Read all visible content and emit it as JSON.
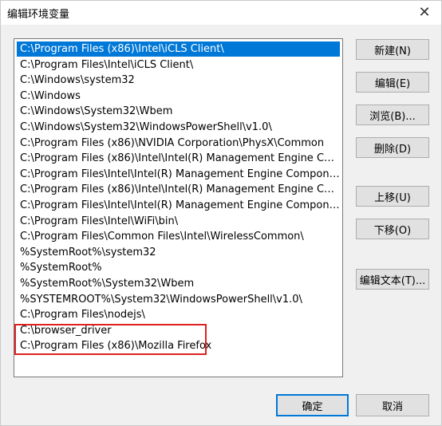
{
  "window": {
    "title": "编辑环境变量",
    "close_glyph": "✕"
  },
  "list": {
    "items": [
      {
        "text": "C:\\Program Files (x86)\\Intel\\iCLS Client\\",
        "selected": true
      },
      {
        "text": "C:\\Program Files\\Intel\\iCLS Client\\",
        "selected": false
      },
      {
        "text": "C:\\Windows\\system32",
        "selected": false
      },
      {
        "text": "C:\\Windows",
        "selected": false
      },
      {
        "text": "C:\\Windows\\System32\\Wbem",
        "selected": false
      },
      {
        "text": "C:\\Windows\\System32\\WindowsPowerShell\\v1.0\\",
        "selected": false
      },
      {
        "text": "C:\\Program Files (x86)\\NVIDIA Corporation\\PhysX\\Common",
        "selected": false
      },
      {
        "text": "C:\\Program Files (x86)\\Intel\\Intel(R) Management Engine Compon...",
        "selected": false
      },
      {
        "text": "C:\\Program Files\\Intel\\Intel(R) Management Engine Components\\...",
        "selected": false
      },
      {
        "text": "C:\\Program Files (x86)\\Intel\\Intel(R) Management Engine Compon...",
        "selected": false
      },
      {
        "text": "C:\\Program Files\\Intel\\Intel(R) Management Engine Components\\I...",
        "selected": false
      },
      {
        "text": "C:\\Program Files\\Intel\\WiFi\\bin\\",
        "selected": false
      },
      {
        "text": "C:\\Program Files\\Common Files\\Intel\\WirelessCommon\\",
        "selected": false
      },
      {
        "text": "%SystemRoot%\\system32",
        "selected": false
      },
      {
        "text": "%SystemRoot%",
        "selected": false
      },
      {
        "text": "%SystemRoot%\\System32\\Wbem",
        "selected": false
      },
      {
        "text": "%SYSTEMROOT%\\System32\\WindowsPowerShell\\v1.0\\",
        "selected": false
      },
      {
        "text": "C:\\Program Files\\nodejs\\",
        "selected": false
      },
      {
        "text": "C:\\browser_driver",
        "selected": false
      },
      {
        "text": "C:\\Program Files (x86)\\Mozilla Firefox",
        "selected": false
      }
    ]
  },
  "buttons": {
    "new": "新建(N)",
    "edit": "编辑(E)",
    "browse": "浏览(B)...",
    "delete": "删除(D)",
    "move_up": "上移(U)",
    "move_down": "下移(O)",
    "edit_text": "编辑文本(T)...",
    "ok": "确定",
    "cancel": "取消"
  },
  "colors": {
    "selection": "#0078d7",
    "highlight_border": "#e02020"
  }
}
